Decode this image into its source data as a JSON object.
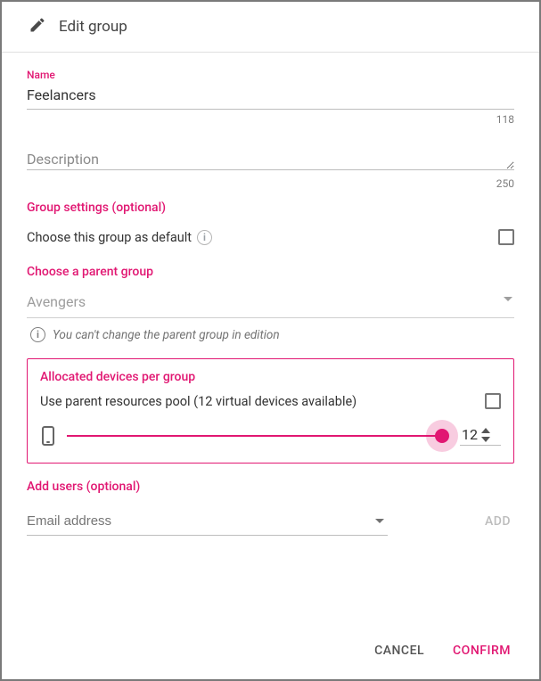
{
  "header": {
    "title": "Edit group"
  },
  "form": {
    "name": {
      "label": "Name",
      "value": "Feelancers",
      "max": "118"
    },
    "description": {
      "placeholder": "Description",
      "value": "",
      "max": "250"
    },
    "group_settings": {
      "title": "Group settings (optional)",
      "default_group_label": "Choose this group as default"
    },
    "parent_group": {
      "title": "Choose a parent group",
      "value": "Avengers",
      "note": "You can't change the parent group in edition"
    },
    "allocated": {
      "title": "Allocated devices per group",
      "pool_label": "Use parent resources pool (12 virtual devices available)",
      "value": "12"
    },
    "add_users": {
      "title": "Add users (optional)",
      "email_placeholder": "Email address",
      "add_button": "ADD"
    }
  },
  "footer": {
    "cancel": "CANCEL",
    "confirm": "CONFIRM"
  }
}
